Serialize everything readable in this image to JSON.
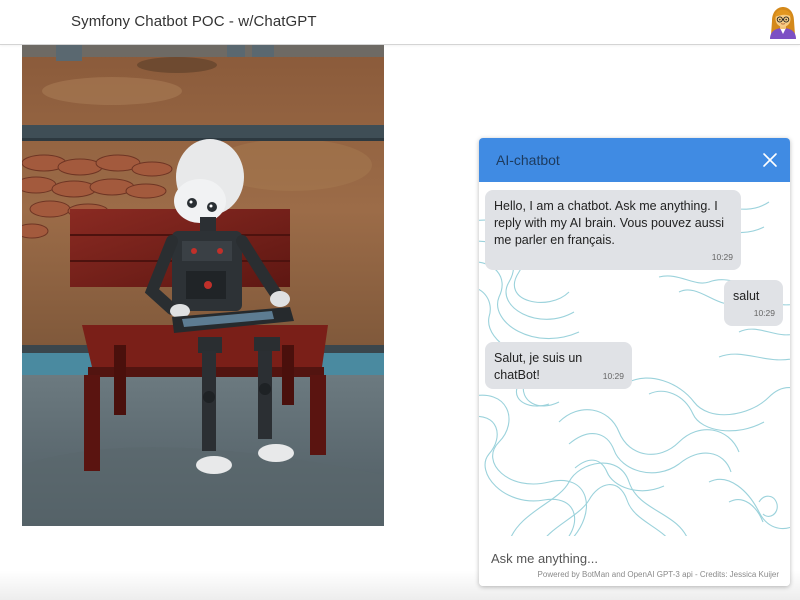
{
  "header": {
    "title": "Symfony Chatbot POC - w/ChatGPT",
    "avatar_icon": "woman-avatar-icon"
  },
  "hero_image": {
    "description_icon": "robot-on-bench-photo"
  },
  "chat": {
    "title": "AI-chatbot",
    "close_icon": "close-icon",
    "accent_color": "#408be3",
    "messages": [
      {
        "sender": "bot",
        "text": "Hello, I am a chatbot. Ask me anything. I reply with my AI brain. Vous pouvez aussi me parler en français.",
        "time": "10:29"
      },
      {
        "sender": "user",
        "text": "salut",
        "time": "10:29"
      },
      {
        "sender": "bot",
        "text": "Salut, je suis un chatBot!",
        "time": "10:29"
      }
    ],
    "input": {
      "placeholder": "Ask me anything...",
      "value": ""
    },
    "credits": "Powered by BotMan and OpenAI GPT-3 api - Credits: Jessica Kuijer"
  }
}
